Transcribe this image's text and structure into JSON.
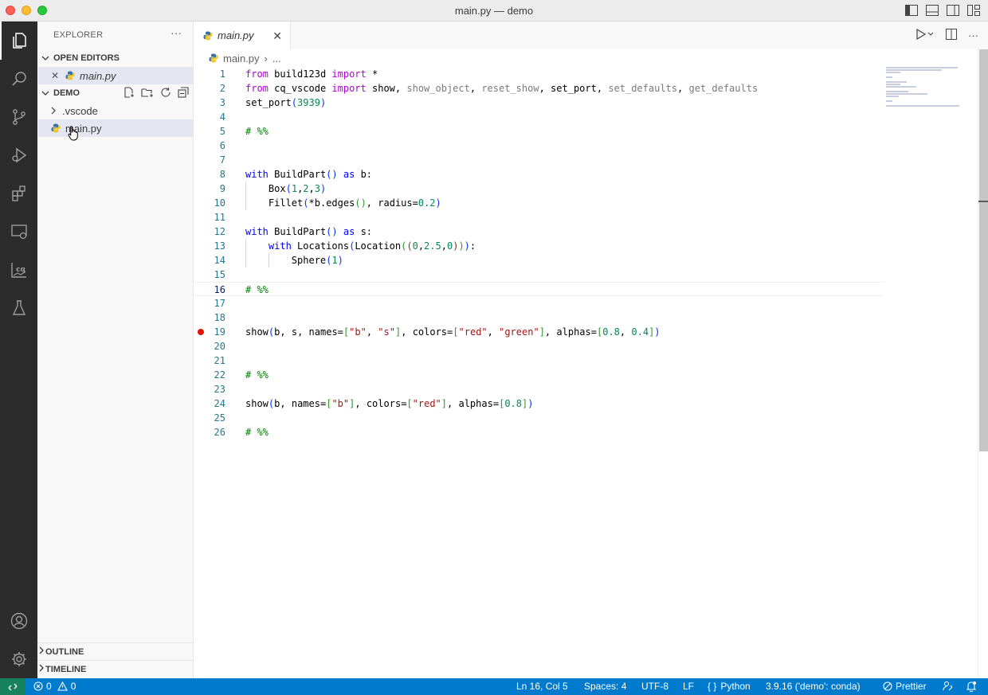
{
  "window": {
    "title": "main.py — demo"
  },
  "sidebar": {
    "title": "EXPLORER",
    "more": "···",
    "open_editors": {
      "label": "OPEN EDITORS",
      "file": "main.py",
      "close": "✕"
    },
    "folder": {
      "label": "DEMO",
      "items": [
        {
          "name": ".vscode",
          "type": "folder"
        },
        {
          "name": "main.py",
          "type": "python-file"
        }
      ]
    },
    "outline_label": "OUTLINE",
    "timeline_label": "TIMELINE"
  },
  "editor": {
    "tab": {
      "label": "main.py",
      "close": "✕"
    },
    "breadcrumb": {
      "file": "main.py",
      "sep": "›",
      "rest": "..."
    },
    "current_line": 16,
    "breakpoint_line": 19,
    "lines": [
      "from build123d import *",
      "from cq_vscode import show, show_object, reset_show, set_port, set_defaults, get_defaults",
      "set_port(3939)",
      "",
      "# %%",
      "",
      "",
      "with BuildPart() as b:",
      "    Box(1,2,3)",
      "    Fillet(*b.edges(), radius=0.2)",
      "",
      "with BuildPart() as s:",
      "    with Locations(Location((0,2.5,0))):",
      "        Sphere(1)",
      "",
      "# %%",
      "",
      "",
      "show(b, s, names=[\"b\", \"s\"], colors=[\"red\", \"green\"], alphas=[0.8, 0.4])",
      "",
      "",
      "# %%",
      "",
      "show(b, names=[\"b\"], colors=[\"red\"], alphas=[0.8])",
      "",
      "# %%"
    ]
  },
  "statusbar": {
    "errors": "0",
    "warnings": "0",
    "position": "Ln 16, Col 5",
    "spaces": "Spaces: 4",
    "encoding": "UTF-8",
    "eol": "LF",
    "language": "Python",
    "interpreter": "3.9.16 ('demo': conda)",
    "formatter": "Prettier"
  },
  "colors": {
    "statusbar": "#007acc",
    "activitybar": "#2c2c2c",
    "breakpoint": "#e51400"
  }
}
